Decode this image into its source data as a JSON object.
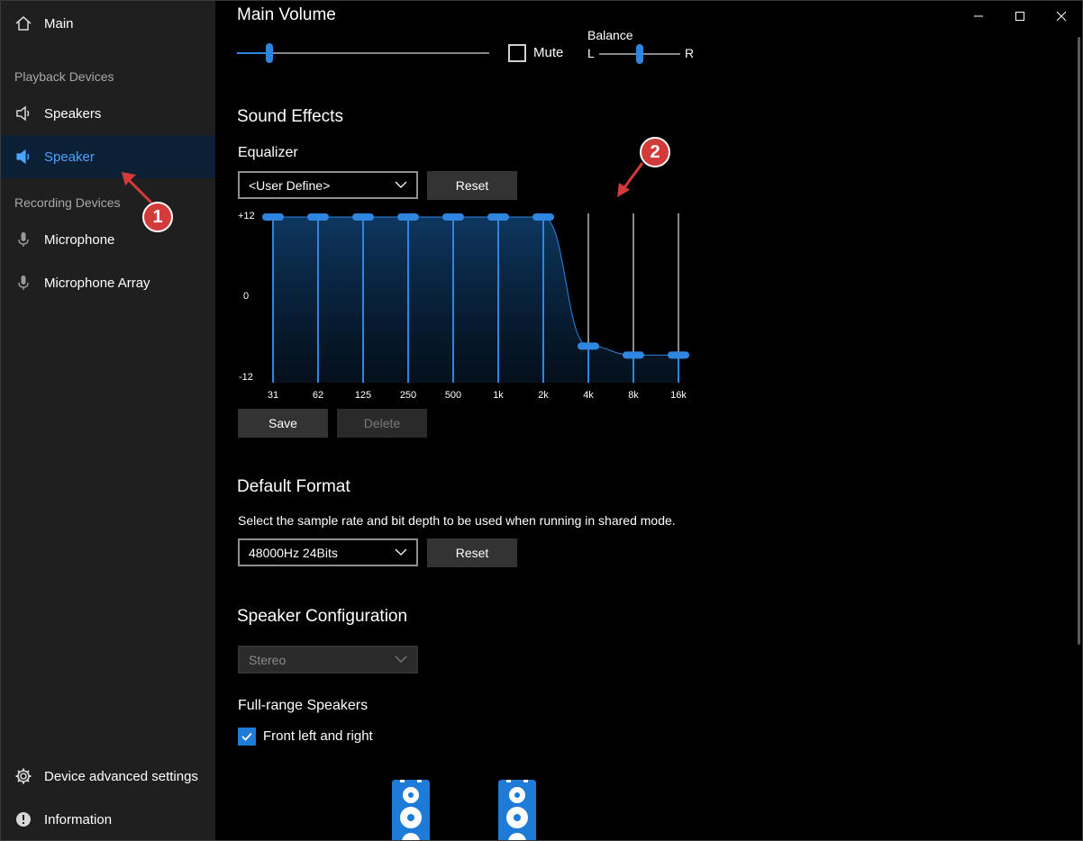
{
  "sidebar": {
    "main": "Main",
    "playback_section": "Playback Devices",
    "playback": [
      {
        "label": "Speakers",
        "active": false
      },
      {
        "label": "Speaker",
        "active": true
      }
    ],
    "recording_section": "Recording Devices",
    "recording": [
      {
        "label": "Microphone"
      },
      {
        "label": "Microphone Array"
      }
    ],
    "device_advanced": "Device advanced settings",
    "information": "Information"
  },
  "main_volume": {
    "title": "Main Volume",
    "volume_level": 0.13,
    "mute_label": "Mute",
    "muted": false,
    "balance_label": "Balance",
    "balance_left": "L",
    "balance_right": "R",
    "balance_position": 0.5
  },
  "sound_effects": {
    "title": "Sound Effects",
    "equalizer_label": "Equalizer",
    "preset": "<User Define>",
    "reset_label": "Reset",
    "save_label": "Save",
    "delete_label": "Delete",
    "axis_top": "+12",
    "axis_mid": "0",
    "axis_bottom": "-12",
    "bands": [
      {
        "freq": "31",
        "gain": 12
      },
      {
        "freq": "62",
        "gain": 12
      },
      {
        "freq": "125",
        "gain": 12
      },
      {
        "freq": "250",
        "gain": 12
      },
      {
        "freq": "500",
        "gain": 12
      },
      {
        "freq": "1k",
        "gain": 12
      },
      {
        "freq": "2k",
        "gain": 12
      },
      {
        "freq": "4k",
        "gain": -6.7
      },
      {
        "freq": "8k",
        "gain": -8
      },
      {
        "freq": "16k",
        "gain": -8
      }
    ]
  },
  "default_format": {
    "title": "Default Format",
    "description": "Select the sample rate and bit depth to be used when running in shared mode.",
    "value": "48000Hz 24Bits",
    "reset_label": "Reset"
  },
  "speaker_config": {
    "title": "Speaker Configuration",
    "value": "Stereo",
    "full_range_label": "Full-range Speakers",
    "front_lr_label": "Front left and right",
    "front_lr_checked": true
  },
  "annotations": {
    "badge1": "1",
    "badge2": "2"
  },
  "colors": {
    "accent": "#2f86e0",
    "sidebar_bg": "#1f1f1f",
    "active_bg": "#0b2034",
    "annotation_red": "#d33a3a"
  }
}
